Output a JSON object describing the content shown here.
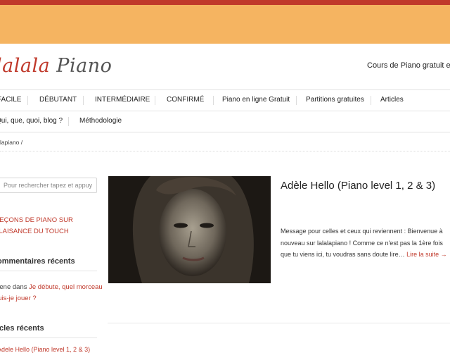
{
  "site": {
    "logo_text_a": "lalala",
    "logo_text_b": "Piano",
    "tagline": "Cours de Piano gratuit en lig"
  },
  "nav": {
    "row1": [
      "FACILE",
      "DÉBUTANT",
      "INTERMÉDIAIRE",
      "CONFIRMÉ",
      "Piano en ligne Gratuit",
      "Partitions gratuites",
      "Articles"
    ],
    "row2": [
      "Qui, que, quoi, blog ?",
      "Méthodologie"
    ]
  },
  "breadcrumb": "lapiano /",
  "sidebar": {
    "search_placeholder": "Pour rechercher tapez et appuy",
    "promo_lines": [
      "LEÇONS DE PIANO SUR",
      "PLAISANCE DU TOUCH"
    ],
    "recent_comments_heading": "ommentaires récents",
    "comment_author_text": "dlene dans ",
    "comment_link": "Je débute, quel morceau puis-je jouer ?",
    "recent_articles_heading": "icles récents",
    "recent_article_first": "Adele Hello (Piano level 1, 2 & 3)"
  },
  "post": {
    "title": "Adèle Hello (Piano level 1, 2 & 3)",
    "excerpt": "Message pour celles et ceux qui reviennent : Bienvenue à nouveau sur lalalapiano ! Comme ce n'est pas la 1ère fois que tu viens ici, tu voudras sans doute lire…",
    "read_more": "Lire la suite →",
    "image_alt": "Adele portrait"
  },
  "colors": {
    "top_bar": "#c0392b",
    "banner": "#f5b461",
    "accent": "#c0392b",
    "text": "#222222"
  }
}
